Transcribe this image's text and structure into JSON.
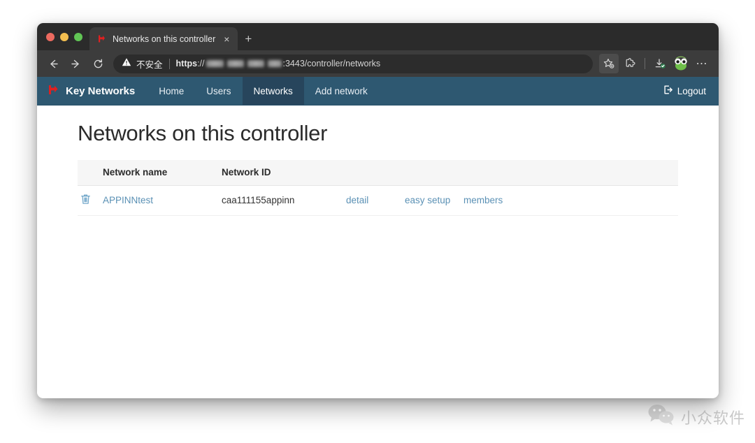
{
  "browser": {
    "traffic_lights": [
      "close",
      "minimize",
      "maximize"
    ],
    "tab": {
      "title": "Networks on this controller",
      "favicon": "red-flag-icon",
      "close_label": "×"
    },
    "new_tab_label": "+",
    "toolbar": {
      "back_label": "←",
      "forward_label": "→",
      "reload_label": "↻",
      "security_label": "不安全",
      "url_scheme": "https",
      "url_separator": "://",
      "url_redacted_segments": 4,
      "url_port_path": ":3443/controller/networks",
      "bookmark_icon": "star-plus-icon",
      "extensions_icon": "puzzle-icon",
      "downloads_icon": "download-check-icon",
      "profile_icon": "frog-avatar",
      "menu_label": "⋯"
    }
  },
  "app": {
    "brand": "Key Networks",
    "brand_icon": "red-flag-logo",
    "nav_items": [
      {
        "label": "Home",
        "active": false
      },
      {
        "label": "Users",
        "active": false
      },
      {
        "label": "Networks",
        "active": true
      },
      {
        "label": "Add network",
        "active": false
      }
    ],
    "logout": {
      "label": "Logout",
      "icon": "sign-out-icon"
    },
    "navbar_color": "#2e5871",
    "navbar_active_color": "#27455c"
  },
  "main": {
    "page_title": "Networks on this controller",
    "table": {
      "columns": [
        "Network name",
        "Network ID"
      ],
      "rows": [
        {
          "delete_icon": "trash-icon",
          "network_name": "APPINNtest",
          "network_id": "caa111155appinn",
          "actions": [
            "detail",
            "easy setup",
            "members"
          ]
        }
      ]
    },
    "link_color": "#5b91b5"
  },
  "watermark": {
    "text": "小众软件",
    "icon": "wechat-icon"
  }
}
